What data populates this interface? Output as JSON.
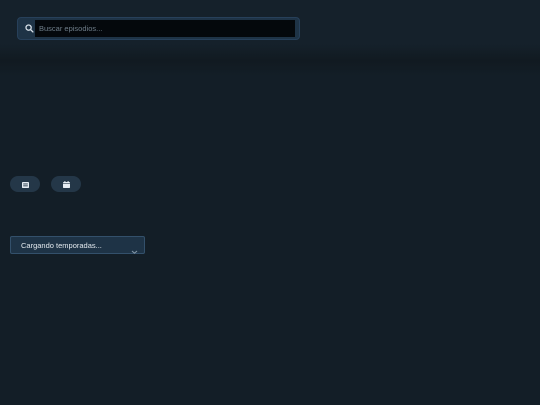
{
  "search": {
    "placeholder": "Buscar episodios...",
    "value": "",
    "icon": "search-icon"
  },
  "view_toggles": [
    {
      "icon": "list-view-icon"
    },
    {
      "icon": "calendar-icon"
    }
  ],
  "season_select": {
    "selected": "Cargando temporadas...",
    "icon": "chevron-down-icon"
  },
  "colors": {
    "background": "#131e27",
    "surface": "#1e3346",
    "pill": "#243748",
    "input": "#04080c"
  }
}
